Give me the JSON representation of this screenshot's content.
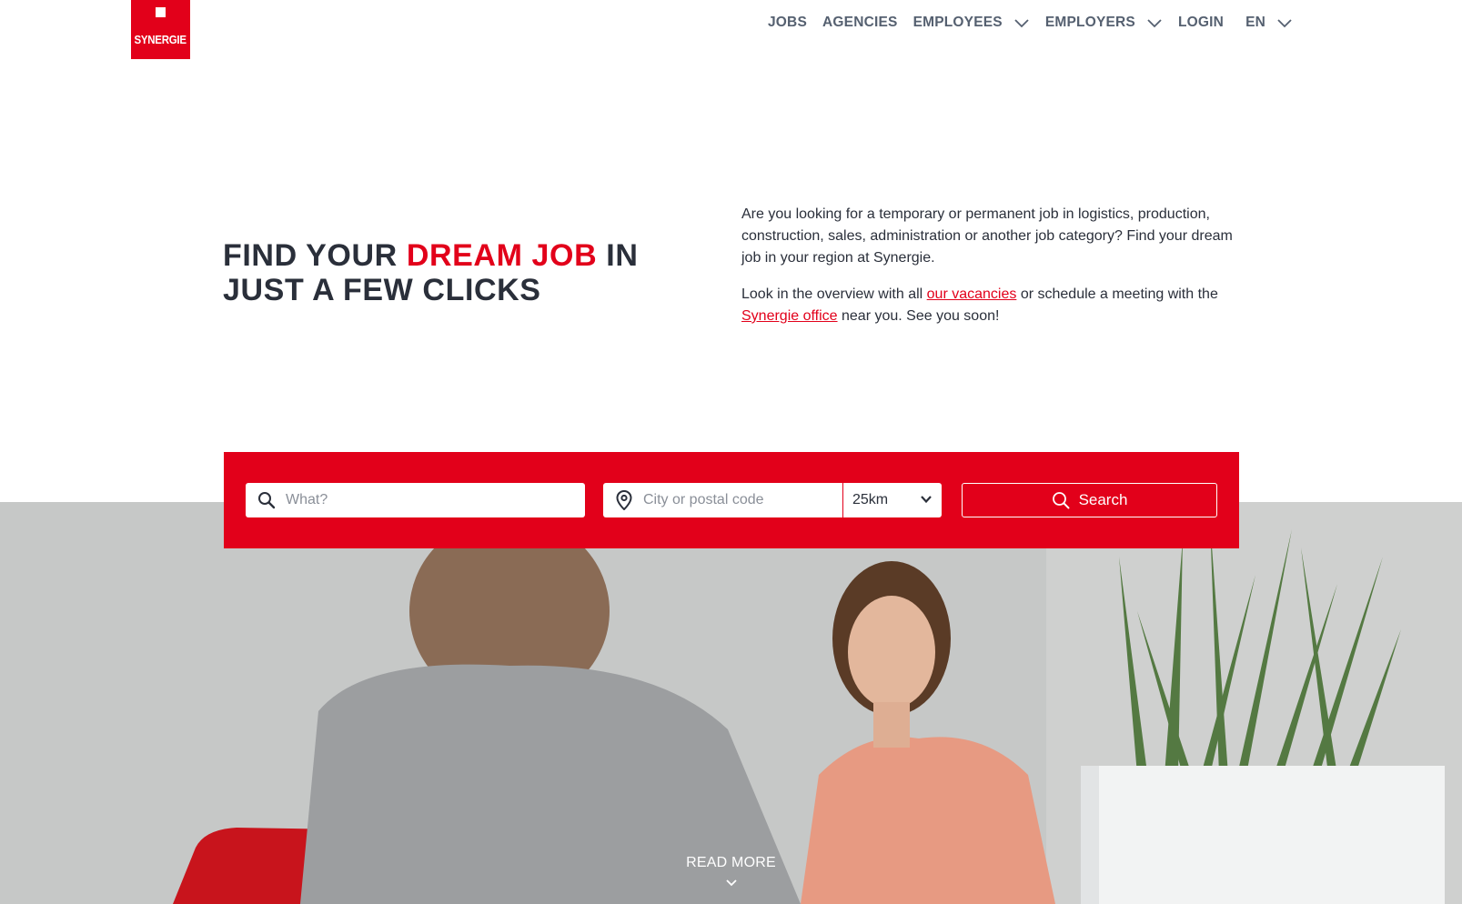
{
  "brand": {
    "logo_text": "SYNERGIE",
    "accent_color": "#e2001a"
  },
  "nav": {
    "items": [
      {
        "label": "JOBS",
        "dropdown": false
      },
      {
        "label": "AGENCIES",
        "dropdown": false
      },
      {
        "label": "EMPLOYEES",
        "dropdown": true
      },
      {
        "label": "EMPLOYERS",
        "dropdown": true
      },
      {
        "label": "LOGIN",
        "dropdown": false
      }
    ],
    "language": "EN"
  },
  "hero": {
    "title_part1": "FIND YOUR ",
    "title_accent": "DREAM JOB",
    "title_part2": " IN JUST A FEW CLICKS",
    "intro_p1": "Are you looking for a temporary or permanent job in logistics, production, construction, sales, administration or another job category? Find your dream job in your region at Synergie.",
    "intro_p2_before": "Look in the overview with all ",
    "intro_p2_link1": "our vacancies",
    "intro_p2_middle": " or schedule a meeting with the ",
    "intro_p2_link2": "Synergie office",
    "intro_p2_after": " near you. See you soon!"
  },
  "search": {
    "what_placeholder": "What?",
    "where_placeholder": "City or postal code",
    "radius_value": "25km",
    "button_label": "Search"
  },
  "read_more": {
    "label": "READ MORE"
  },
  "icons": {
    "search": "search-icon",
    "location": "map-pin-icon",
    "chevron": "chevron-down-icon"
  }
}
